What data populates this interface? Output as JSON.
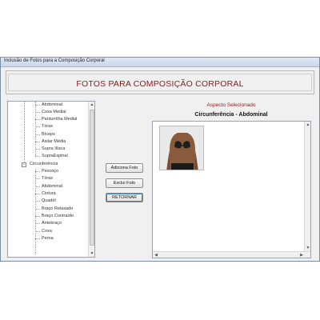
{
  "window": {
    "title": "Inclusão de Fotos para a Composição Corporal"
  },
  "header": {
    "title": "FOTOS PARA COMPOSIÇÃO CORPORAL"
  },
  "tree": {
    "items": [
      "Abdominal",
      "Coxa Medial",
      "Panturrilha Medial",
      "Tórax",
      "Bíceps",
      "Axilar Média",
      "Supra Ilíaca",
      "SupraEspinal",
      "Circunferência",
      "Pescoço",
      "Tórax",
      "Abdominal",
      "Cintura",
      "Quadril",
      "Braço Relaxado",
      "Braço Contraído",
      "Antebraço",
      "Coxa",
      "Perna"
    ]
  },
  "buttons": {
    "add": "Adiciona Foto",
    "delete": "Exclui Foto",
    "back": "RETORNAR"
  },
  "selection": {
    "aspect_label": "Aspecto Selecionado",
    "current": "Circunferência - Abdominal"
  },
  "icons": {
    "expander_expanded": "minus-box-icon"
  }
}
